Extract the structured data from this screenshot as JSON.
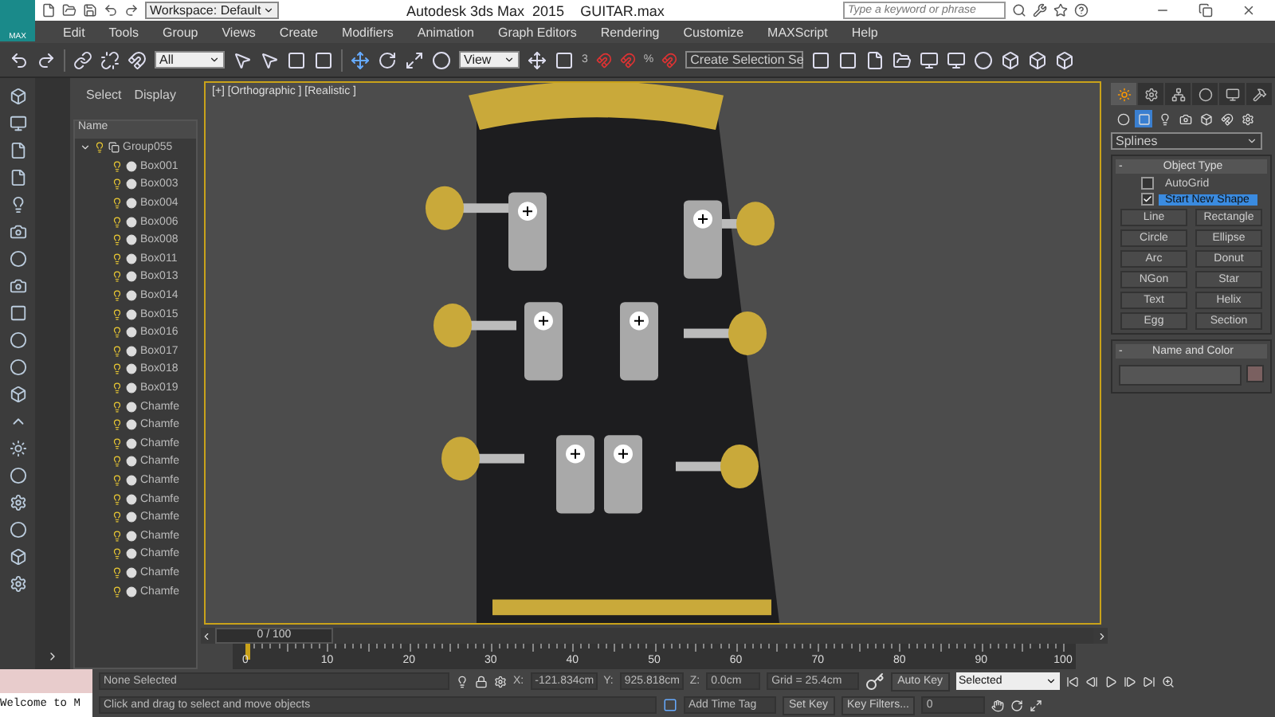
{
  "title_bar": {
    "logo": "MAX",
    "workspace": "Workspace: Default",
    "title": "Autodesk 3ds Max  2015    GUITAR.max",
    "search_placeholder": "Type a keyword or phrase"
  },
  "menu": [
    "Edit",
    "Tools",
    "Group",
    "Views",
    "Create",
    "Modifiers",
    "Animation",
    "Graph Editors",
    "Rendering",
    "Customize",
    "MAXScript",
    "Help"
  ],
  "toolbar": {
    "filter": "All",
    "reference": "View",
    "snap_angle": "3",
    "snap_percent": "%",
    "selection_set": "Create Selection Se"
  },
  "scene_explorer": {
    "tabs": [
      "Select",
      "Display"
    ],
    "column": "Name",
    "tree": {
      "label": "Group055",
      "expanded": true,
      "children": [
        {
          "label": "Box001"
        },
        {
          "label": "Box003"
        },
        {
          "label": "Box004"
        },
        {
          "label": "Box006"
        },
        {
          "label": "Box008"
        },
        {
          "label": "Box011"
        },
        {
          "label": "Box013"
        },
        {
          "label": "Box014"
        },
        {
          "label": "Box015"
        },
        {
          "label": "Box016"
        },
        {
          "label": "Box017"
        },
        {
          "label": "Box018"
        },
        {
          "label": "Box019"
        },
        {
          "label": "Chamfe"
        },
        {
          "label": "Chamfe"
        },
        {
          "label": "Chamfe"
        },
        {
          "label": "Chamfe"
        },
        {
          "label": "Chamfe"
        },
        {
          "label": "Chamfe"
        },
        {
          "label": "Chamfe"
        },
        {
          "label": "Chamfe"
        },
        {
          "label": "Chamfe"
        },
        {
          "label": "Chamfe"
        },
        {
          "label": "Chamfe"
        }
      ]
    }
  },
  "viewport": {
    "label": "[+] [Orthographic ] [Realistic ]"
  },
  "command_panel": {
    "tabs": [
      {
        "kind": "create",
        "selected": true
      },
      {
        "kind": "modify",
        "selected": false
      },
      {
        "kind": "hierarchy",
        "selected": false
      },
      {
        "kind": "motion",
        "selected": false
      },
      {
        "kind": "display",
        "selected": false
      },
      {
        "kind": "utilities",
        "selected": false
      }
    ],
    "categories": [
      {
        "kind": "geometry",
        "selected": false
      },
      {
        "kind": "shapes",
        "selected": true
      },
      {
        "kind": "lights",
        "selected": false
      },
      {
        "kind": "cameras",
        "selected": false
      },
      {
        "kind": "helpers",
        "selected": false
      },
      {
        "kind": "spacewarps",
        "selected": false
      },
      {
        "kind": "systems",
        "selected": false
      }
    ],
    "dropdown": "Splines",
    "object_type": {
      "title": "Object Type",
      "collapse": "-",
      "autogrid": {
        "label": "AutoGrid",
        "checked": false
      },
      "start_new_shape": {
        "label": "Start New Shape",
        "checked": true
      },
      "buttons": [
        "Line",
        "Rectangle",
        "Circle",
        "Ellipse",
        "Arc",
        "Donut",
        "NGon",
        "Star",
        "Text",
        "Helix",
        "Egg",
        "Section"
      ]
    },
    "name_and_color": {
      "title": "Name and Color",
      "collapse": "-"
    }
  },
  "timeline": {
    "frame": "0 / 100",
    "level": 0,
    "ticks": [
      "0",
      "10",
      "20",
      "30",
      "40",
      "50",
      "60",
      "70",
      "80",
      "90",
      "100"
    ]
  },
  "status": {
    "listener": "Welcome to M",
    "selection": "None Selected",
    "prompt": "Click and drag to select and move objects",
    "x_label": "X:",
    "x": "-121.834cm",
    "y_label": "Y:",
    "y": "925.818cm",
    "z_label": "Z:",
    "z": "0.0cm",
    "grid": "Grid = 25.4cm",
    "add_time_tag": "Add Time Tag",
    "auto_key": "Auto Key",
    "key_mode": "Selected",
    "set_key": "Set Key",
    "key_filters": "Key Filters...",
    "frame": "0"
  }
}
